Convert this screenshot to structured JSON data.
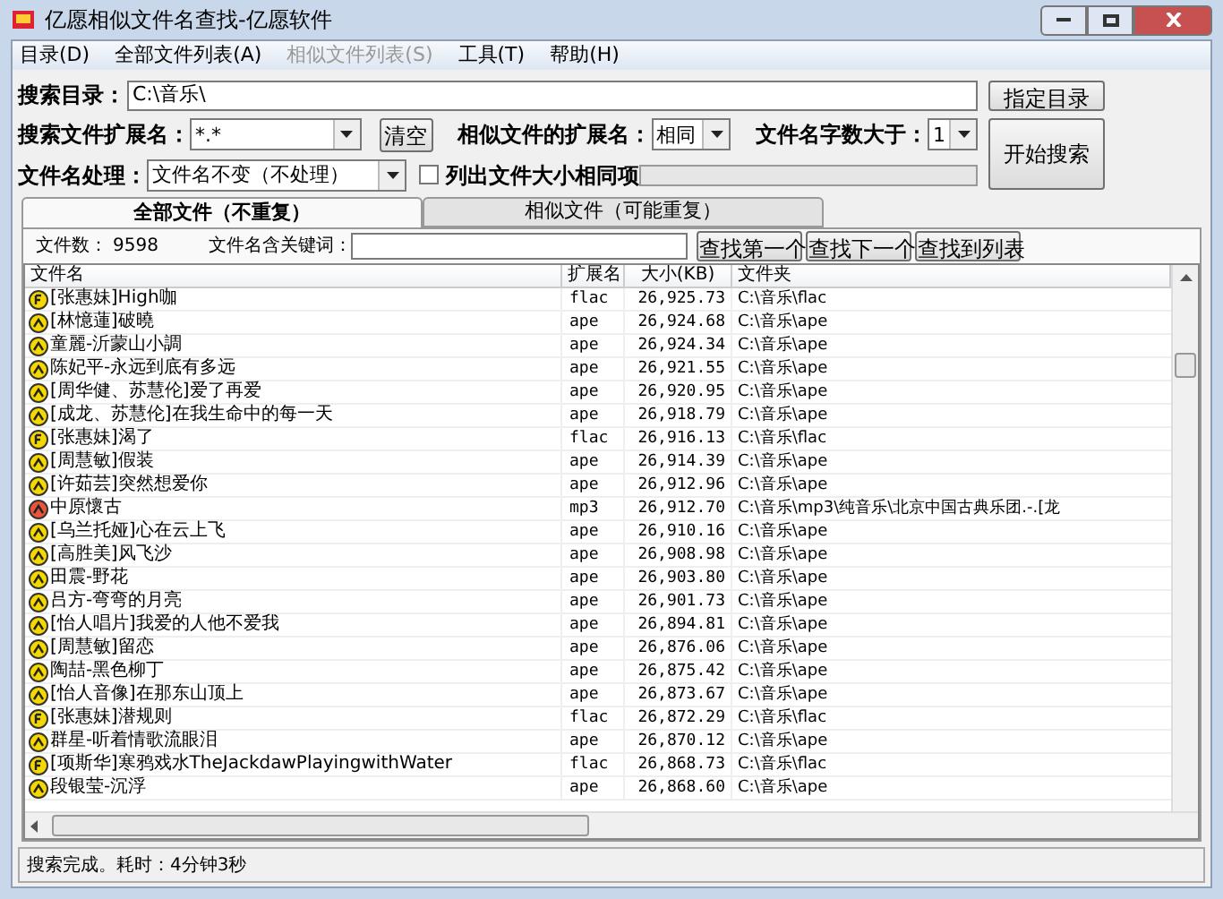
{
  "window": {
    "title": "亿愿相似文件名查找-亿愿软件"
  },
  "menu": [
    {
      "label": "目录(D)",
      "disabled": false
    },
    {
      "label": "全部文件列表(A)",
      "disabled": false
    },
    {
      "label": "相似文件列表(S)",
      "disabled": true
    },
    {
      "label": "工具(T)",
      "disabled": false
    },
    {
      "label": "帮助(H)",
      "disabled": false
    }
  ],
  "form": {
    "search_dir_label": "搜索目录：",
    "search_dir_value": "C:\\音乐\\",
    "choose_dir_button": "指定目录",
    "ext_label": "搜索文件扩展名：",
    "ext_value": "*.*",
    "clear_button": "清空",
    "similar_ext_label": "相似文件的扩展名：",
    "similar_ext_value": "相同",
    "min_chars_label": "文件名字数大于：",
    "min_chars_value": "1",
    "start_button": "开始搜索",
    "name_mode_label": "文件名处理：",
    "name_mode_value": "文件名不变（不处理）",
    "same_size_label": "列出文件大小相同项",
    "same_size_checked": false,
    "progress": {
      "level": 0
    }
  },
  "tabs": [
    {
      "label": "全部文件（不重复）",
      "selected": true
    },
    {
      "label": "相似文件（可能重复）",
      "selected": false
    }
  ],
  "toolbar": {
    "count_label": "文件数：",
    "count": "9598",
    "keyword_label": "文件名含关键词：",
    "buttons": [
      "查找第一个",
      "查找下一个",
      "查找到列表"
    ]
  },
  "table": {
    "columns": [
      "文件名",
      "扩展名",
      "大小(KB)",
      "文件夹"
    ],
    "rows": [
      {
        "kind": "flac",
        "name": "[张惠妹]High咖",
        "ext": "flac",
        "size": "26,925.73",
        "folder": "C:\\音乐\\flac"
      },
      {
        "kind": "ape",
        "name": "[林憶蓮]破曉",
        "ext": "ape",
        "size": "26,924.68",
        "folder": "C:\\音乐\\ape"
      },
      {
        "kind": "ape",
        "name": "童麗-沂蒙山小調",
        "ext": "ape",
        "size": "26,924.34",
        "folder": "C:\\音乐\\ape"
      },
      {
        "kind": "ape",
        "name": "陈妃平-永远到底有多远",
        "ext": "ape",
        "size": "26,921.55",
        "folder": "C:\\音乐\\ape"
      },
      {
        "kind": "ape",
        "name": "[周华健、苏慧伦]爱了再爱",
        "ext": "ape",
        "size": "26,920.95",
        "folder": "C:\\音乐\\ape"
      },
      {
        "kind": "ape",
        "name": "[成龙、苏慧伦]在我生命中的每一天",
        "ext": "ape",
        "size": "26,918.79",
        "folder": "C:\\音乐\\ape"
      },
      {
        "kind": "flac",
        "name": "[张惠妹]渴了",
        "ext": "flac",
        "size": "26,916.13",
        "folder": "C:\\音乐\\flac"
      },
      {
        "kind": "ape",
        "name": "[周慧敏]假装",
        "ext": "ape",
        "size": "26,914.39",
        "folder": "C:\\音乐\\ape"
      },
      {
        "kind": "ape",
        "name": "[许茹芸]突然想爱你",
        "ext": "ape",
        "size": "26,912.96",
        "folder": "C:\\音乐\\ape"
      },
      {
        "kind": "mp3",
        "name": "中原懷古",
        "ext": "mp3",
        "size": "26,912.70",
        "folder": "C:\\音乐\\mp3\\纯音乐\\北京中国古典乐团.-.[龙"
      },
      {
        "kind": "ape",
        "name": "[乌兰托娅]心在云上飞",
        "ext": "ape",
        "size": "26,910.16",
        "folder": "C:\\音乐\\ape"
      },
      {
        "kind": "ape",
        "name": "[高胜美]风飞沙",
        "ext": "ape",
        "size": "26,908.98",
        "folder": "C:\\音乐\\ape"
      },
      {
        "kind": "ape",
        "name": "田震-野花",
        "ext": "ape",
        "size": "26,903.80",
        "folder": "C:\\音乐\\ape"
      },
      {
        "kind": "ape",
        "name": "吕方-弯弯的月亮",
        "ext": "ape",
        "size": "26,901.73",
        "folder": "C:\\音乐\\ape"
      },
      {
        "kind": "ape",
        "name": "[怡人唱片]我爱的人他不爱我",
        "ext": "ape",
        "size": "26,894.81",
        "folder": "C:\\音乐\\ape"
      },
      {
        "kind": "ape",
        "name": "[周慧敏]留恋",
        "ext": "ape",
        "size": "26,876.06",
        "folder": "C:\\音乐\\ape"
      },
      {
        "kind": "ape",
        "name": "陶喆-黑色柳丁",
        "ext": "ape",
        "size": "26,875.42",
        "folder": "C:\\音乐\\ape"
      },
      {
        "kind": "ape",
        "name": "[怡人音像]在那东山顶上",
        "ext": "ape",
        "size": "26,873.67",
        "folder": "C:\\音乐\\ape"
      },
      {
        "kind": "flac",
        "name": "[张惠妹]潜规则",
        "ext": "flac",
        "size": "26,872.29",
        "folder": "C:\\音乐\\flac"
      },
      {
        "kind": "ape",
        "name": "群星-听着情歌流眼泪",
        "ext": "ape",
        "size": "26,870.12",
        "folder": "C:\\音乐\\ape"
      },
      {
        "kind": "flac",
        "name": "[项斯华]寒鸦戏水TheJackdawPlayingwithWater",
        "ext": "flac",
        "size": "26,868.73",
        "folder": "C:\\音乐\\flac"
      },
      {
        "kind": "ape",
        "name": "段银莹-沉浮",
        "ext": "ape",
        "size": "26,868.60",
        "folder": "C:\\音乐\\ape"
      }
    ]
  },
  "status_bar": "搜索完成。耗时：4分钟3秒"
}
